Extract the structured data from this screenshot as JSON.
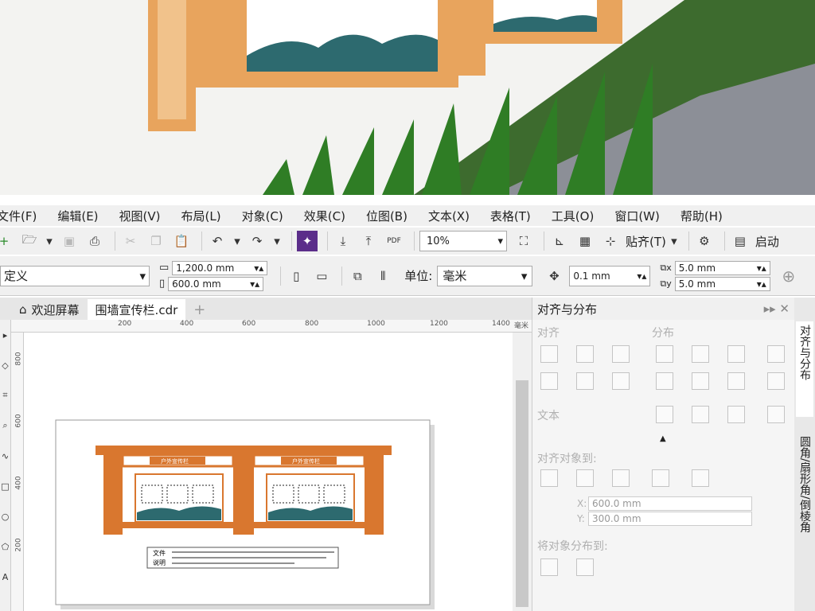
{
  "menu": [
    "文件(F)",
    "编辑(E)",
    "视图(V)",
    "布局(L)",
    "对象(C)",
    "效果(C)",
    "位图(B)",
    "文本(X)",
    "表格(T)",
    "工具(O)",
    "窗口(W)",
    "帮助(H)"
  ],
  "toolbar": {
    "zoom_value": "10%",
    "paste_label": "贴齐(T)",
    "launch_label": "启动",
    "pdf_label": "PDF"
  },
  "propertybar": {
    "preset": "定义",
    "width": "1,200.0 mm",
    "height": "600.0 mm",
    "unit_label": "单位:",
    "unit_value": "毫米",
    "nudge": "0.1 mm",
    "dup_x": "5.0 mm",
    "dup_y": "5.0 mm"
  },
  "tabs": {
    "welcome": "欢迎屏幕",
    "document": "围墙宣传栏.cdr",
    "add": "+"
  },
  "ruler": {
    "h_ticks": [
      "200",
      "400",
      "600",
      "800",
      "1000",
      "1200",
      "1400",
      "毫米"
    ],
    "v_ticks": [
      "800",
      "600",
      "400",
      "200"
    ]
  },
  "canvas_doc": {
    "panel_title_left": "户外宣传栏",
    "panel_title_right": "户外宣传栏",
    "note_line1": "文件",
    "note_line2": "说明"
  },
  "docker": {
    "title": "对齐与分布",
    "align": "对齐",
    "distribute": "分布",
    "text": "文本",
    "align_to": "对齐对象到:",
    "x_value": "600.0 mm",
    "y_value": "300.0 mm",
    "x_label": "X:",
    "y_label": "Y:",
    "distribute_to": "将对象分布到:"
  },
  "sidetabs": [
    "对齐与分布",
    "圆角/扇形角/倒棱角"
  ],
  "colors": {
    "frame": "#e8a45d",
    "orange": "#d9772f",
    "ui_bg": "#f0f0f0"
  }
}
